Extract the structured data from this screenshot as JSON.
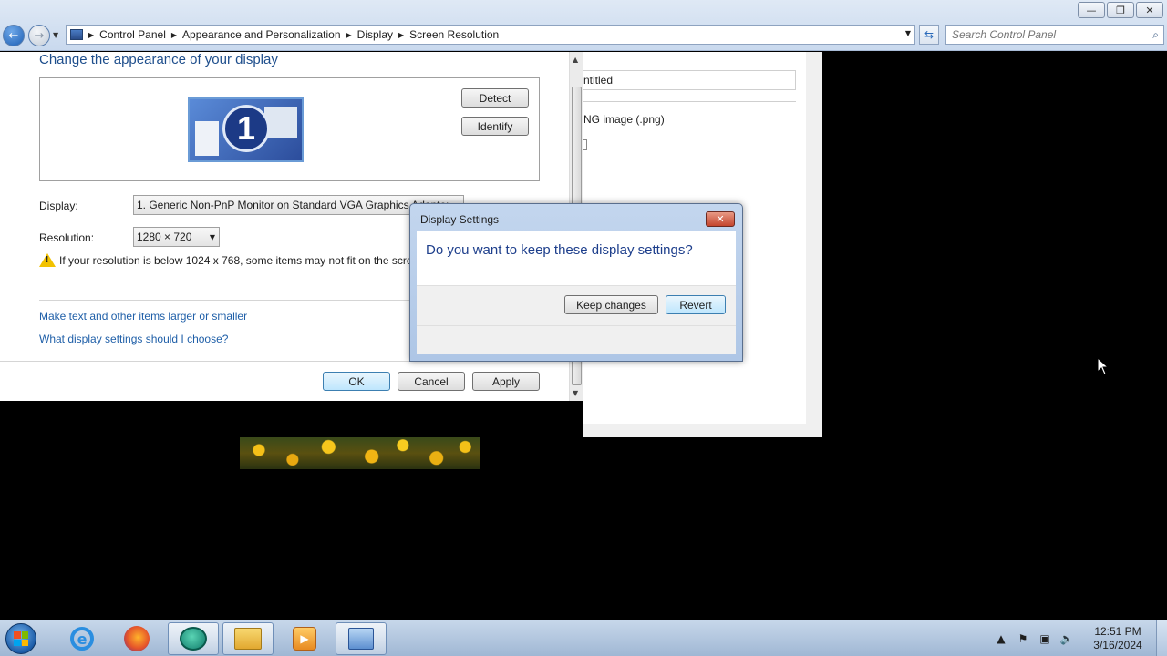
{
  "window": {
    "minimize": "—",
    "maximize": "❐",
    "close": "✕"
  },
  "navbar": {
    "back": "←",
    "forward": "→",
    "breadcrumbs": [
      "Control Panel",
      "Appearance and Personalization",
      "Display",
      "Screen Resolution"
    ],
    "search_placeholder": "Search Control Panel"
  },
  "main": {
    "title": "Change the appearance of your display",
    "monitor_number": "1",
    "detect": "Detect",
    "identify": "Identify",
    "display_label": "Display:",
    "display_value": "1. Generic Non-PnP Monitor on Standard VGA Graphics Adapter",
    "resolution_label": "Resolution:",
    "resolution_value": "1280 × 720",
    "warning": "If your resolution is below 1024 x 768, some items may not fit on the screen.",
    "link_larger": "Make text and other items larger or smaller",
    "link_which": "What display settings should I choose?",
    "ok": "OK",
    "cancel": "Cancel",
    "apply": "Apply"
  },
  "background_window": {
    "filename": "ntitled",
    "filetype": "NG image (.png)"
  },
  "dialog": {
    "title": "Display Settings",
    "close": "✕",
    "question": "Do you want to keep these display settings?",
    "keep": "Keep changes",
    "revert": "Revert"
  },
  "taskbar": {
    "apps": [
      "internet-explorer",
      "firefox",
      "chat",
      "file-explorer",
      "media-player",
      "control-panel"
    ],
    "time": "12:51 PM",
    "date": "3/16/2024"
  }
}
